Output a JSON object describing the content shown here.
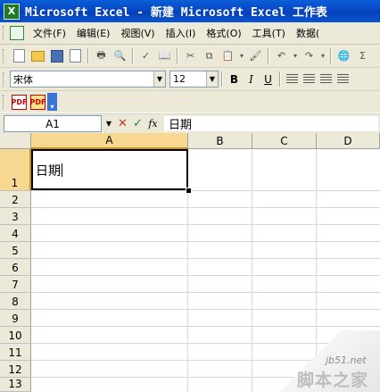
{
  "window": {
    "title": "Microsoft Excel - 新建 Microsoft Excel 工作表",
    "icon": "excel-icon"
  },
  "menu": {
    "items": [
      "文件(F)",
      "编辑(E)",
      "视图(V)",
      "插入(I)",
      "格式(O)",
      "工具(T)",
      "数据("
    ]
  },
  "format_toolbar": {
    "font_name": "宋体",
    "font_size": "12",
    "bold": "B",
    "italic": "I",
    "underline": "U"
  },
  "formula_bar": {
    "name_box": "A1",
    "cancel": "✕",
    "enter": "✓",
    "fx": "fx",
    "value": "日期"
  },
  "sheet": {
    "columns": [
      "A",
      "B",
      "C",
      "D"
    ],
    "rows": [
      "1",
      "2",
      "3",
      "4",
      "5",
      "6",
      "7",
      "8",
      "9",
      "10",
      "11",
      "12",
      "13"
    ],
    "active_cell": "A1",
    "cells": {
      "A1": "日期"
    }
  },
  "watermark": {
    "site": "jb51.net",
    "name": "脚本之家"
  },
  "colors": {
    "titlebar": "#0a55d0",
    "chrome": "#ece9d8",
    "header_selected": "#f8d890",
    "gridline": "#d0d7e5"
  }
}
